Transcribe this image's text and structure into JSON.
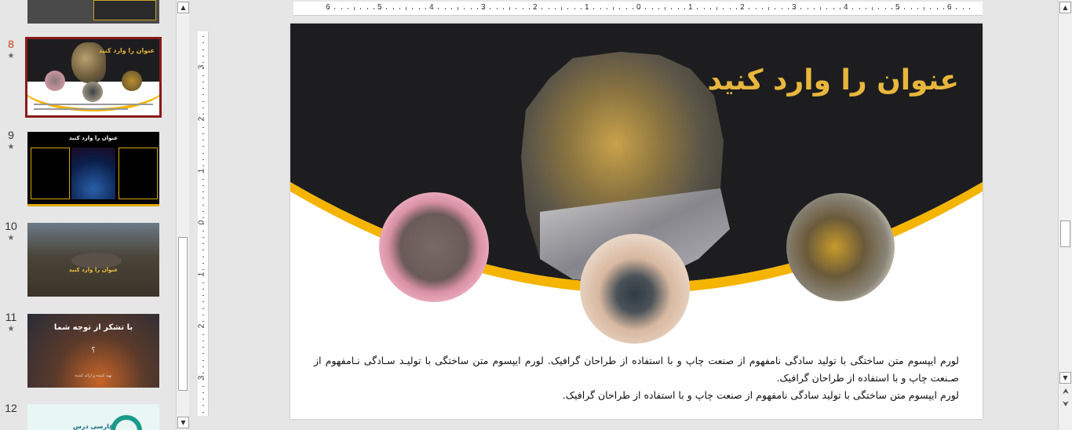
{
  "slides_pane": {
    "items": [
      {
        "number": "8",
        "star": "★",
        "title": "عنوان را وارد کنید",
        "selected": true
      },
      {
        "number": "9",
        "star": "★",
        "title": "عنوان را وارد کنید"
      },
      {
        "number": "10",
        "star": "★",
        "title": "عنوان را وارد کنید"
      },
      {
        "number": "11",
        "star": "★",
        "title": "با تشکر از توجه شما",
        "subtitle": "؟",
        "caption": "تهیه کننده و ارائه کننده"
      },
      {
        "number": "12",
        "logo_text": "فارسی درس"
      }
    ]
  },
  "ruler": {
    "horizontal": [
      "6",
      "5",
      "4",
      "3",
      "2",
      "1",
      "0",
      "1",
      "2",
      "3",
      "4",
      "5",
      "6"
    ],
    "vertical": [
      "3",
      "2",
      "1",
      "0",
      "1",
      "2",
      "3"
    ]
  },
  "slide": {
    "title": "عنوان را وارد کنید",
    "body": [
      "لورم ایپسوم متن ساختگی با تولید سادگی نامفهوم از صنعت چاپ و با استفاده از طراحان گرافیک. لورم ایپسوم متن ساختگی با تولیـد سـادگی نـامفهوم از صـنعت چاپ و با استفاده از طراحان گرافیک.",
      "لورم ایپسوم متن ساختگی با تولید سادگی نامفهوم از صنعت چاپ و با استفاده از طراحان گرافیک."
    ]
  },
  "colors": {
    "accent_gold": "#e8b63c",
    "arc_yellow": "#f4b400",
    "slide_dark": "#1d1d1f",
    "selection_frame": "#8b1a1a"
  },
  "icons": {
    "scroll_up": "triangle-up-icon",
    "scroll_down": "triangle-down-icon",
    "prev_slide": "double-chevron-up-icon",
    "next_slide": "double-chevron-down-icon"
  }
}
